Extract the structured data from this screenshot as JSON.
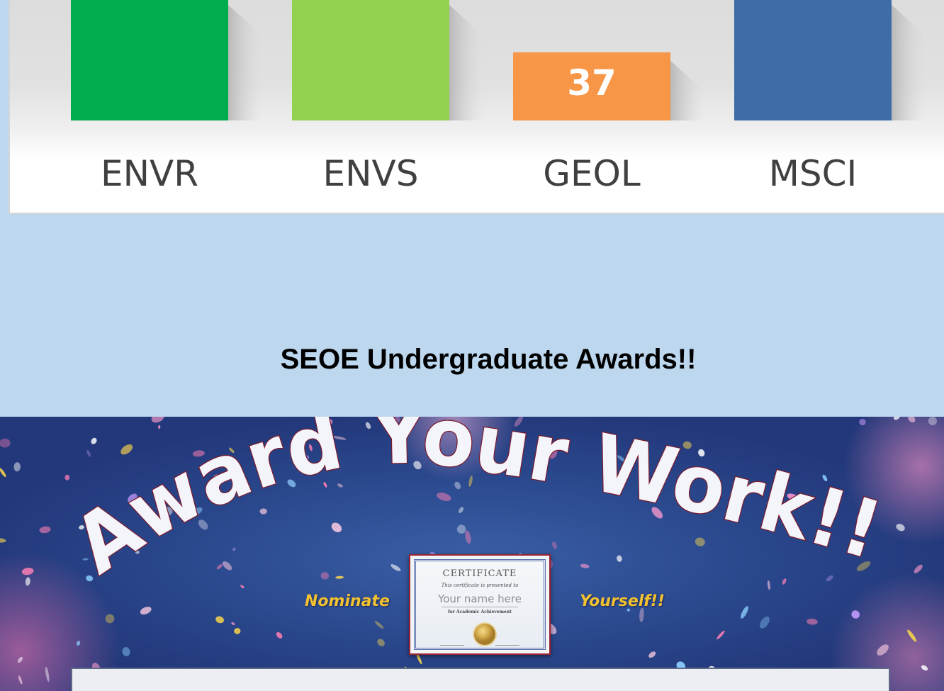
{
  "chart_data": {
    "type": "bar",
    "categories": [
      "ENVR",
      "ENVS",
      "GEOL",
      "MSCI"
    ],
    "values": [
      null,
      null,
      37,
      null
    ],
    "data_labels": [
      "",
      "",
      "37",
      ""
    ],
    "colors": [
      "#00ad4e",
      "#92d050",
      "#f79646",
      "#3d6ca7"
    ]
  },
  "section": {
    "title": "SEOE Undergraduate Awards!!"
  },
  "banner": {
    "headline": "Award Your Work!!",
    "tagline_left": "Nominate",
    "tagline_right": "Yourself!!",
    "certificate": {
      "title": "CERTIFICATE",
      "presented": "This certificate is presented to",
      "name": "Your name here",
      "for": "for Academic Achievement"
    }
  }
}
